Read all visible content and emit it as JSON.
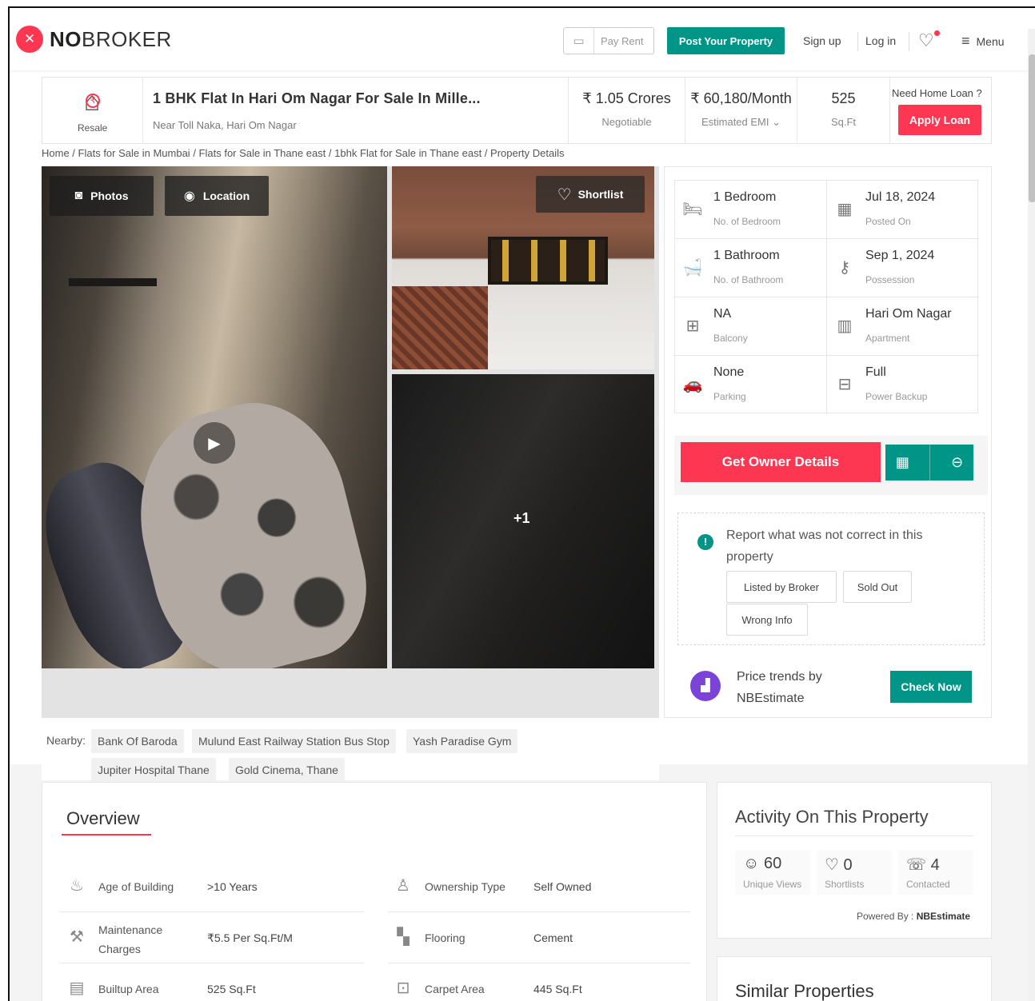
{
  "header": {
    "brand_bold": "NO",
    "brand_light": "BROKER",
    "pay_rent": "Pay Rent",
    "post_property": "Post Your Property",
    "sign_up": "Sign up",
    "log_in": "Log in",
    "menu": "Menu",
    "accent_color": "#fd3752",
    "teal_color": "#009587"
  },
  "summary": {
    "type_label": "Resale",
    "title": "1 BHK Flat In Hari Om Nagar For Sale In Mille...",
    "subtitle": "Near Toll Naka, Hari Om Nagar",
    "price": "₹ 1.05 Crores",
    "price_note": "Negotiable",
    "emi": "₹ 60,180/Month",
    "emi_note": "Estimated EMI",
    "area": "525",
    "area_unit": "Sq.Ft",
    "loan_question": "Need Home Loan ?",
    "apply_loan": "Apply Loan"
  },
  "breadcrumb": [
    "Home",
    "Flats for Sale in Mumbai",
    "Flats for Sale in Thane east",
    "1bhk Flat for Sale in Thane east",
    "Property Details"
  ],
  "gallery": {
    "photos_label": "Photos",
    "location_label": "Location",
    "shortlist_label": "Shortlist",
    "more_count": "+1"
  },
  "details": [
    {
      "icon": "bed-icon",
      "value": "1 Bedroom",
      "label": "No. of Bedroom"
    },
    {
      "icon": "calendar-icon",
      "value": "Jul 18, 2024",
      "label": "Posted On"
    },
    {
      "icon": "bathtub-icon",
      "value": "1 Bathroom",
      "label": "No. of Bathroom"
    },
    {
      "icon": "key-icon",
      "value": "Sep 1, 2024",
      "label": "Possession"
    },
    {
      "icon": "balcony-icon",
      "value": "NA",
      "label": "Balcony"
    },
    {
      "icon": "building-icon",
      "value": "Hari Om Nagar",
      "label": "Apartment"
    },
    {
      "icon": "car-icon",
      "value": "None",
      "label": "Parking"
    },
    {
      "icon": "battery-icon",
      "value": "Full",
      "label": "Power Backup"
    }
  ],
  "owner": {
    "button": "Get Owner Details"
  },
  "report": {
    "text": "Report what was not correct in this property",
    "buttons": [
      "Listed by Broker",
      "Sold Out",
      "Wrong Info"
    ]
  },
  "trends": {
    "text": "Price trends by NBEstimate",
    "button": "Check Now"
  },
  "nearby": {
    "label": "Nearby:",
    "places": [
      "Bank Of Baroda",
      "Mulund East Railway Station Bus Stop",
      "Yash Paradise Gym",
      "Jupiter Hospital Thane",
      "Gold Cinema, Thane"
    ]
  },
  "overview": {
    "title": "Overview",
    "rows": [
      {
        "icon": "cake-icon",
        "label": "Age of Building",
        "value": ">10 Years"
      },
      {
        "icon": "ownership-icon",
        "label": "Ownership Type",
        "value": "Self Owned"
      },
      {
        "icon": "hammer-icon",
        "label": "Maintenance Charges",
        "value": "₹5.5 Per Sq.Ft/M"
      },
      {
        "icon": "flooring-icon",
        "label": "Flooring",
        "value": "Cement"
      },
      {
        "icon": "builtup-icon",
        "label": "Builtup Area",
        "value": "525 Sq.Ft"
      },
      {
        "icon": "carpet-icon",
        "label": "Carpet Area",
        "value": "445 Sq.Ft"
      }
    ]
  },
  "activity": {
    "title": "Activity On This Property",
    "stats": [
      {
        "icon": "user-icon",
        "value": "60",
        "label": "Unique Views"
      },
      {
        "icon": "heart-icon",
        "value": "0",
        "label": "Shortlists"
      },
      {
        "icon": "phone-icon",
        "value": "4",
        "label": "Contacted"
      }
    ],
    "powered_prefix": "Powered By :",
    "powered_brand": "NBEstimate"
  },
  "similar": {
    "title": "Similar Properties"
  }
}
